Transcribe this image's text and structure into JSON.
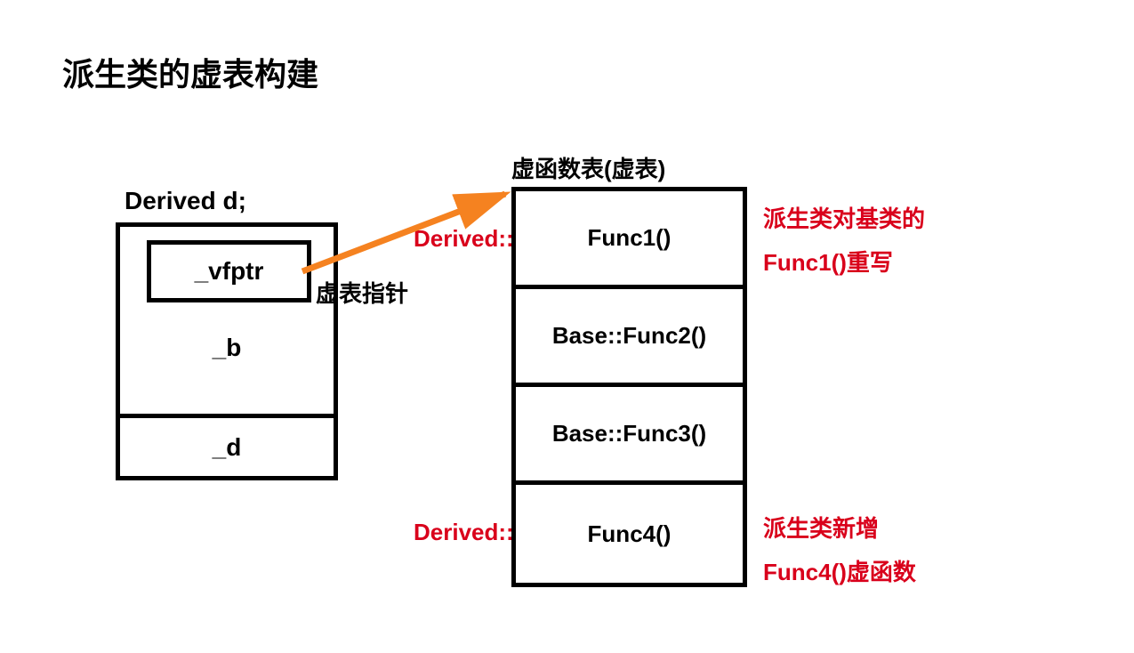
{
  "title": "派生类的虚表构建",
  "object": {
    "declaration": "Derived d;",
    "vfptr": "_vfptr",
    "member_b": "_b",
    "member_d": "_d",
    "ptr_label": "虚表指针"
  },
  "vtable": {
    "title": "虚函数表(虚表)",
    "rows": [
      {
        "prefix": "Derived::",
        "name": "Func1()",
        "prefix_red": true
      },
      {
        "prefix": "Base::",
        "name": "Func2()",
        "prefix_red": false
      },
      {
        "prefix": "Base::",
        "name": "Func3()",
        "prefix_red": false
      },
      {
        "prefix": "Derived::",
        "name": "Func4()",
        "prefix_red": true
      }
    ]
  },
  "notes": {
    "override_line1": "派生类对基类的",
    "override_line2": "Func1()重写",
    "new_line1": "派生类新增",
    "new_line2": "Func4()虚函数"
  },
  "colors": {
    "accent": "#d9001b",
    "arrow": "#f58220"
  }
}
